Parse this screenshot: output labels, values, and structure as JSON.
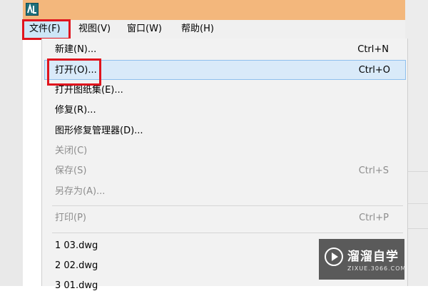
{
  "menubar": {
    "items": [
      {
        "label": "文件(F)"
      },
      {
        "label": "视图(V)"
      },
      {
        "label": "窗口(W)"
      },
      {
        "label": "帮助(H)"
      }
    ]
  },
  "file_menu": {
    "items": [
      {
        "label": "新建(N)...",
        "shortcut": "Ctrl+N",
        "enabled": true
      },
      {
        "label": "打开(O)...",
        "shortcut": "Ctrl+O",
        "enabled": true,
        "highlighted": true
      },
      {
        "label": "打开图纸集(E)...",
        "shortcut": "",
        "enabled": true
      },
      {
        "label": "修复(R)...",
        "shortcut": "",
        "enabled": true
      },
      {
        "label": "图形修复管理器(D)...",
        "shortcut": "",
        "enabled": true
      },
      {
        "label": "关闭(C)",
        "shortcut": "",
        "enabled": false
      },
      {
        "label": "保存(S)",
        "shortcut": "Ctrl+S",
        "enabled": false
      },
      {
        "label": "另存为(A)...",
        "shortcut": "",
        "enabled": false
      },
      {
        "label": "打印(P)",
        "shortcut": "Ctrl+P",
        "enabled": false
      },
      {
        "label": "1 03.dwg",
        "shortcut": "",
        "enabled": true
      },
      {
        "label": "2 02.dwg",
        "shortcut": "",
        "enabled": true
      },
      {
        "label": "3 01.dwg",
        "shortcut": "",
        "enabled": true
      }
    ]
  },
  "watermark": {
    "brand": "溜溜自学",
    "site": "ZIXUE.3066.COM"
  },
  "colors": {
    "titlebar": "#f3b77c",
    "highlight_border": "#e0141e",
    "hover_fill": "#d9eaf9"
  }
}
